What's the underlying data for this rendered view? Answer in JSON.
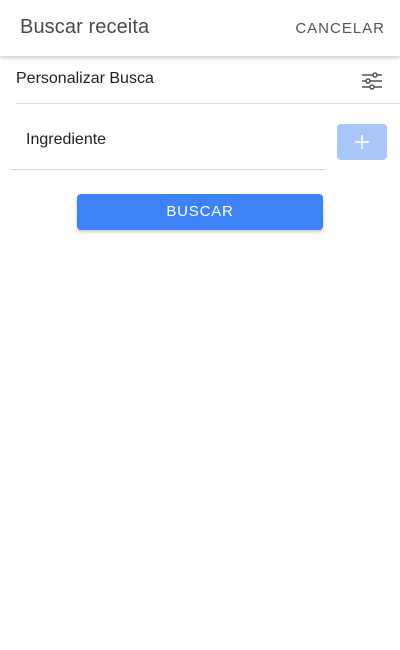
{
  "header": {
    "title": "Buscar receita",
    "cancel_label": "CANCELAR"
  },
  "customize": {
    "label": "Personalizar Busca",
    "icon": "tune-icon"
  },
  "ingredient": {
    "placeholder": "Ingrediente",
    "value": ""
  },
  "add_button": {
    "icon": "plus-icon",
    "color": "#a8c6f7"
  },
  "search_button": {
    "label": "BUSCAR",
    "color": "#3d82f6"
  }
}
